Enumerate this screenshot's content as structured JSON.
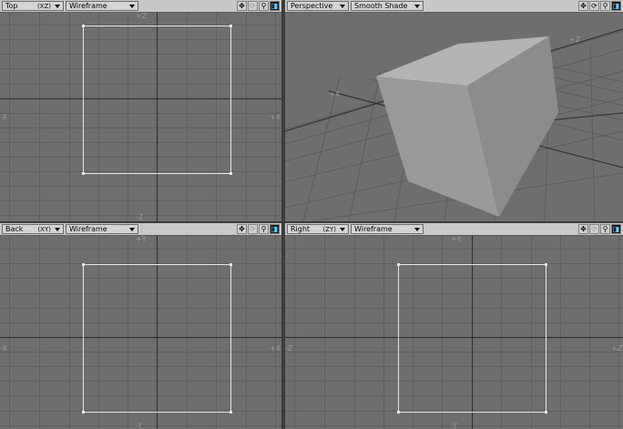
{
  "viewports": {
    "top": {
      "view": "Top",
      "plane": "(XZ)",
      "mode": "Wireframe",
      "axis_top": "+Z",
      "axis_bottom": "-Z",
      "axis_left": "-X",
      "axis_right": "+X"
    },
    "perspective": {
      "view": "Perspective",
      "mode": "Smooth Shade",
      "axis_x": "+X",
      "axis_z": "+Z"
    },
    "back": {
      "view": "Back",
      "plane": "(XY)",
      "mode": "Wireframe",
      "axis_top": "+Y",
      "axis_bottom": "-Y",
      "axis_left": "-X",
      "axis_right": "+X"
    },
    "right": {
      "view": "Right",
      "plane": "(ZY)",
      "mode": "Wireframe",
      "axis_top": "+Y",
      "axis_bottom": "-Y",
      "axis_left": "-Z",
      "axis_right": "+Z"
    }
  },
  "tool_icons": [
    "move-view-icon",
    "rotate-view-icon",
    "zoom-view-icon",
    "maximize-view-icon"
  ],
  "colors": {
    "viewport_bg": "#6e6e6e",
    "grid": "#5f5f5f",
    "axis": "#2a2a2a",
    "wire": "#e6e6e6",
    "header": "#c8c8c8",
    "cube_front": "#9a9a9a",
    "cube_top": "#b4b4b4",
    "cube_side": "#8c8c8c"
  }
}
